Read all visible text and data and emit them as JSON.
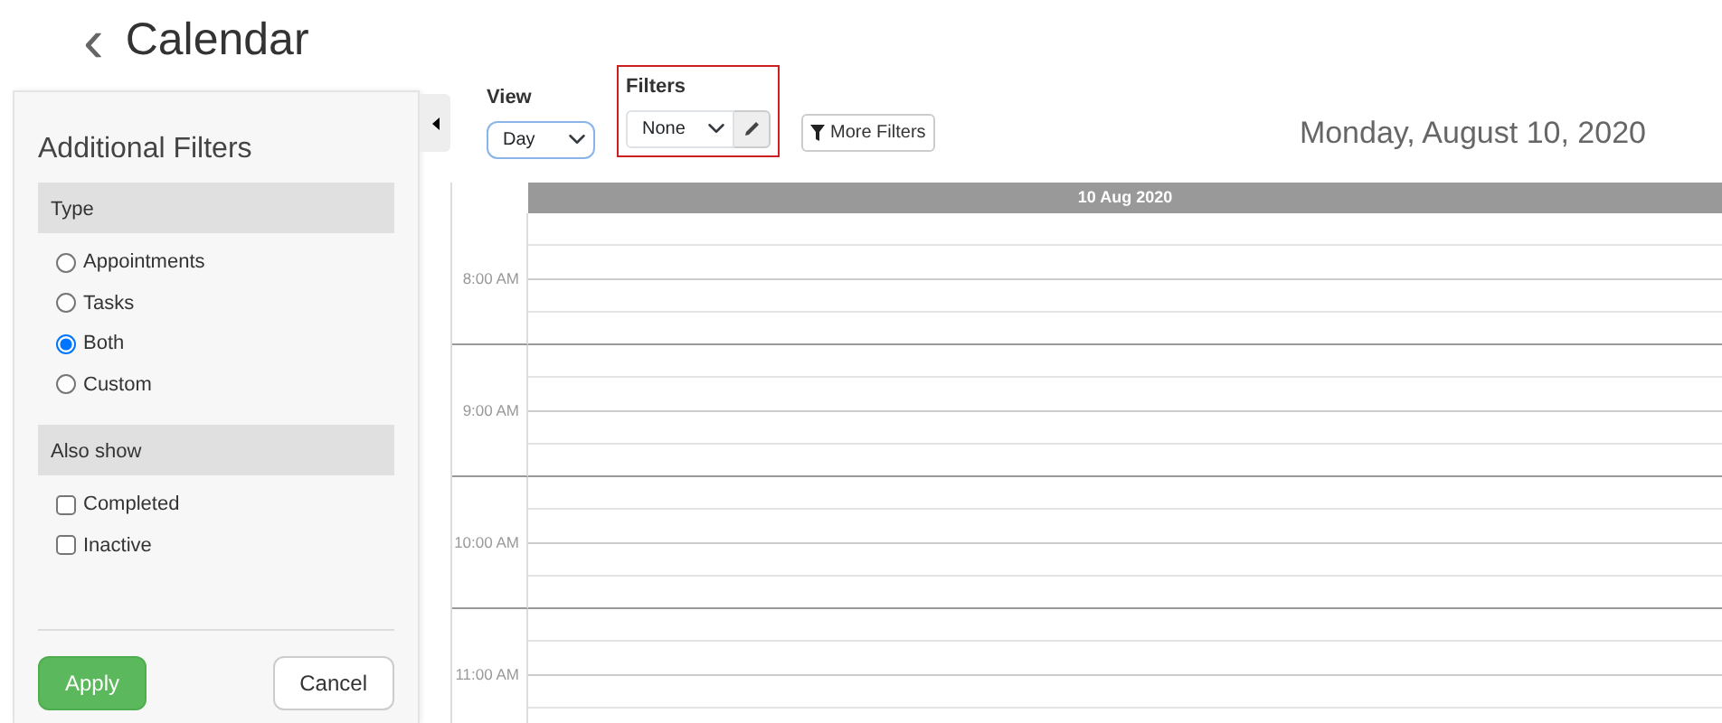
{
  "page": {
    "back_icon": "‹",
    "title": "Calendar"
  },
  "filters_panel": {
    "title": "Additional Filters",
    "type_section": {
      "heading": "Type",
      "options": [
        {
          "label": "Appointments",
          "selected": false
        },
        {
          "label": "Tasks",
          "selected": false
        },
        {
          "label": "Both",
          "selected": true
        },
        {
          "label": "Custom",
          "selected": false
        }
      ]
    },
    "also_show_section": {
      "heading": "Also show",
      "options": [
        {
          "label": "Completed",
          "checked": false
        },
        {
          "label": "Inactive",
          "checked": false
        }
      ]
    },
    "buttons": [
      {
        "label": "Apply",
        "kind": "primary"
      },
      {
        "label": "Cancel",
        "kind": "secondary"
      }
    ]
  },
  "toolbar": {
    "view": {
      "label": "View",
      "value": "Day"
    },
    "filters": {
      "label": "Filters",
      "value": "None",
      "highlighted": true
    },
    "more_filters": "More Filters",
    "date": "Monday, August 10, 2020"
  },
  "calendar": {
    "day_header": "10 Aug 2020",
    "hours": [
      "8:00 AM",
      "9:00 AM",
      "10:00 AM",
      "11:00 AM"
    ]
  }
}
